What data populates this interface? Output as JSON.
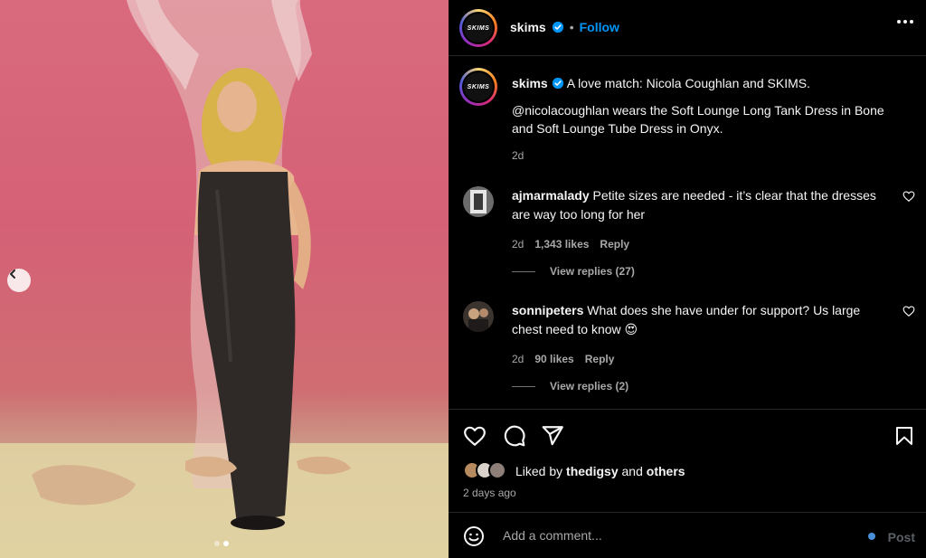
{
  "media": {
    "slide_count": 2,
    "active_slide": 2
  },
  "header": {
    "username": "skims",
    "avatar_text": "SKIMS",
    "separator": "•",
    "follow_label": "Follow"
  },
  "caption": {
    "username": "skims",
    "avatar_text": "SKIMS",
    "line1": "A love match: Nicola Coughlan and SKIMS.",
    "line2": "@nicolacoughlan wears the Soft Lounge Long Tank Dress in Bone and Soft Lounge Tube Dress in Onyx.",
    "time": "2d"
  },
  "comments": [
    {
      "username": "ajmarmalady",
      "text": "Petite sizes are needed - it’s clear that the dresses are way too long for her",
      "time": "2d",
      "likes": "1,343 likes",
      "reply_label": "Reply",
      "view_replies": "View replies (27)"
    },
    {
      "username": "sonnipeters",
      "text": "What does she have under for support? Us large chest need to know",
      "emoji": "😍",
      "time": "2d",
      "likes": "90 likes",
      "reply_label": "Reply",
      "view_replies": "View replies (2)"
    }
  ],
  "likes": {
    "prefix": "Liked by",
    "user": "thedigsy",
    "conjunction": "and",
    "others": "others"
  },
  "post_age": "2 days ago",
  "composer": {
    "placeholder": "Add a comment...",
    "post_label": "Post"
  },
  "icons": {
    "like": "heart-icon",
    "comment": "comment-icon",
    "share": "send-icon",
    "save": "bookmark-icon",
    "emoji": "emoji-icon",
    "more": "more-icon",
    "prev": "chevron-left-icon"
  },
  "colors": {
    "link_blue": "#0095f6",
    "verified_blue": "#0095f6",
    "muted": "#a8a8a8",
    "background": "#000000"
  }
}
